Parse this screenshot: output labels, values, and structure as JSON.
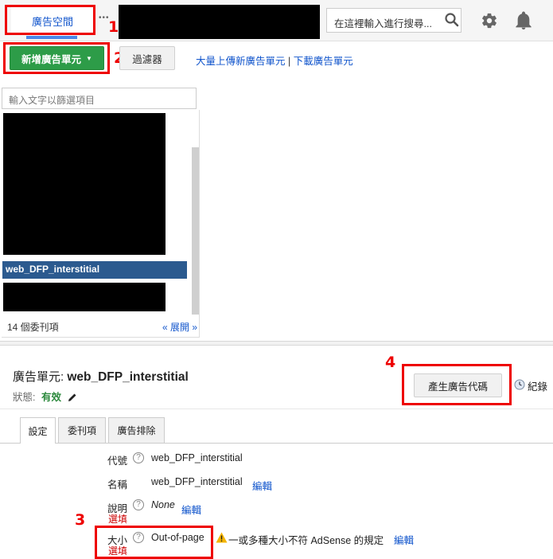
{
  "header": {
    "tab_label": "廣告空間",
    "more_dots": "•••",
    "search_placeholder": "在這裡輸入進行搜尋...",
    "annotation_1": "1"
  },
  "toolbar": {
    "new_unit_label": "新增廣告單元",
    "filter_label": "過濾器",
    "bulk_upload_label": "大量上傳新廣告單元",
    "separator": "|",
    "download_label": "下載廣告單元",
    "annotation_2": "2"
  },
  "list_panel": {
    "filter_placeholder": "輸入文字以篩選項目",
    "selected_item": "web_DFP_interstitial",
    "count_text": "14 個委刊項",
    "expand_label": "« 展開 »"
  },
  "detail": {
    "title_prefix": "廣告單元: ",
    "title_name": "web_DFP_interstitial",
    "status_label": "狀態:",
    "status_value": "有效",
    "generate_tag_label": "產生廣告代碼",
    "history_label": "紀錄",
    "annotation_4": "4",
    "tabs": [
      {
        "label": "設定"
      },
      {
        "label": "委刊項"
      },
      {
        "label": "廣告排除"
      }
    ]
  },
  "fields": {
    "code_label": "代號",
    "code_value": "web_DFP_interstitial",
    "name_label": "名稱",
    "name_value": "web_DFP_interstitial",
    "name_edit": "編輯",
    "desc_label": "說明",
    "desc_optional": "選填",
    "desc_value": "None",
    "desc_edit": "編輯",
    "size_label": "大小",
    "size_optional": "選填",
    "size_value": "Out-of-page",
    "size_warning": "一或多種大小不符 AdSense 的規定",
    "size_edit": "編輯",
    "help_glyph": "?",
    "annotation_3": "3"
  },
  "colors": {
    "primary_green": "#2d9c48",
    "link_blue": "#1155cc",
    "selected_row": "#2b5a8f",
    "annotation_red": "#ee0000"
  }
}
